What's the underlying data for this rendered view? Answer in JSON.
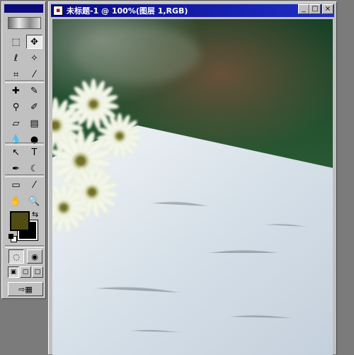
{
  "document": {
    "title": "未标题-1 @ 100%(图层 1,RGB)",
    "icon": "photoshop-document-icon",
    "window_buttons": {
      "minimize": "_",
      "maximize": "□",
      "close": "×"
    }
  },
  "toolbox": {
    "tools": [
      {
        "name": "rect-marquee-icon",
        "glyph": "⬚"
      },
      {
        "name": "move-icon",
        "glyph": "✥"
      },
      {
        "name": "lasso-icon",
        "glyph": "ℓ"
      },
      {
        "name": "magic-wand-icon",
        "glyph": "✧"
      },
      {
        "name": "crop-icon",
        "glyph": "⌗"
      },
      {
        "name": "eyedropper-slice-icon",
        "glyph": "⁄"
      },
      {
        "name": "healing-brush-icon",
        "glyph": "✚"
      },
      {
        "name": "brush-icon",
        "glyph": "✎"
      },
      {
        "name": "clone-stamp-icon",
        "glyph": "⚲"
      },
      {
        "name": "history-brush-icon",
        "glyph": "✐"
      },
      {
        "name": "eraser-icon",
        "glyph": "▱"
      },
      {
        "name": "gradient-icon",
        "glyph": "▤"
      },
      {
        "name": "blur-icon",
        "glyph": "💧"
      },
      {
        "name": "dodge-icon",
        "glyph": "●"
      },
      {
        "name": "path-select-icon",
        "glyph": "↖"
      },
      {
        "name": "type-icon",
        "glyph": "T"
      },
      {
        "name": "pen-icon",
        "glyph": "✒"
      },
      {
        "name": "custom-shape-icon",
        "glyph": "☾"
      },
      {
        "name": "notes-icon",
        "glyph": "▭"
      },
      {
        "name": "eyedropper-icon",
        "glyph": "⁄"
      },
      {
        "name": "hand-icon",
        "glyph": "✋"
      },
      {
        "name": "zoom-icon",
        "glyph": "🔍"
      }
    ],
    "foreground_color": "#4f4c14",
    "background_color": "#000000",
    "swap_colors_icon": "swap-arrow-icon",
    "default_colors_icon": "default-colors-icon"
  }
}
